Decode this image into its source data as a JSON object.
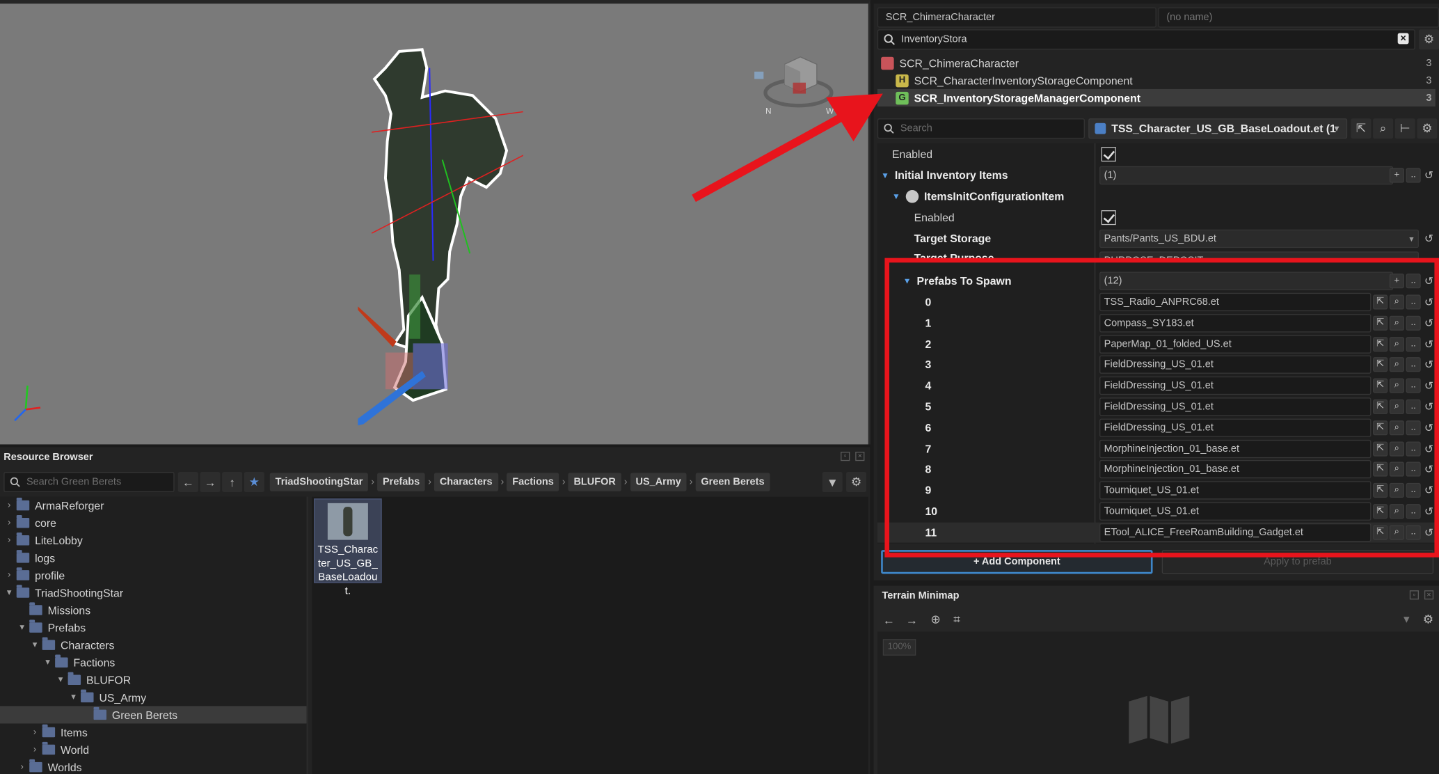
{
  "resource_browser": {
    "title": "Resource Browser",
    "search_placeholder": "Search Green Berets",
    "breadcrumbs": [
      "TriadShootingStar",
      "Prefabs",
      "Characters",
      "Factions",
      "BLUFOR",
      "US_Army",
      "Green Berets"
    ],
    "tree": [
      {
        "label": "ArmaReforger",
        "depth": 0,
        "caret": "›"
      },
      {
        "label": "core",
        "depth": 0,
        "caret": "›"
      },
      {
        "label": "LiteLobby",
        "depth": 0,
        "caret": "›"
      },
      {
        "label": "logs",
        "depth": 0,
        "caret": ""
      },
      {
        "label": "profile",
        "depth": 0,
        "caret": "›"
      },
      {
        "label": "TriadShootingStar",
        "depth": 0,
        "caret": "▾"
      },
      {
        "label": "Missions",
        "depth": 1,
        "caret": ""
      },
      {
        "label": "Prefabs",
        "depth": 1,
        "caret": "▾"
      },
      {
        "label": "Characters",
        "depth": 2,
        "caret": "▾"
      },
      {
        "label": "Factions",
        "depth": 3,
        "caret": "▾"
      },
      {
        "label": "BLUFOR",
        "depth": 4,
        "caret": "▾"
      },
      {
        "label": "US_Army",
        "depth": 5,
        "caret": "▾"
      },
      {
        "label": "Green Berets",
        "depth": 6,
        "caret": "",
        "selected": true
      },
      {
        "label": "Items",
        "depth": 2,
        "caret": "›"
      },
      {
        "label": "World",
        "depth": 2,
        "caret": "›"
      },
      {
        "label": "Worlds",
        "depth": 1,
        "caret": "›"
      }
    ],
    "file": {
      "label": "TSS_Character_US_GB_BaseLoadout."
    }
  },
  "inspector": {
    "entity_class": "SCR_ChimeraCharacter",
    "entity_name_placeholder": "(no name)",
    "component_search": "InventoryStora",
    "components": [
      {
        "label": "SCR_ChimeraCharacter",
        "count": "3",
        "badge": "",
        "badge_color": "#c9545a"
      },
      {
        "label": "SCR_CharacterInventoryStorageComponent",
        "count": "3",
        "badge": "H",
        "badge_color": "#c9b84a"
      },
      {
        "label": "SCR_InventoryStorageManagerComponent",
        "count": "3",
        "badge": "G",
        "badge_color": "#6fbf5a",
        "selected": true
      }
    ],
    "prop_search_placeholder": "Search",
    "prefab_name": "TSS_Character_US_GB_BaseLoadout.et (1",
    "enabled_label": "Enabled",
    "initial_items_label": "Initial Inventory Items",
    "initial_items_count": "(1)",
    "item_config_label": "ItemsInitConfigurationItem",
    "item_enabled_label": "Enabled",
    "target_storage_label": "Target Storage",
    "target_storage_value": "Pants/Pants_US_BDU.et",
    "target_purpose_label": "Target Purpose",
    "target_purpose_value": "PURPOSE_DEPOSIT",
    "prefabs_label": "Prefabs To Spawn",
    "prefabs_count": "(12)",
    "prefabs": [
      {
        "index": "0",
        "value": "TSS_Radio_ANPRC68.et"
      },
      {
        "index": "1",
        "value": "Compass_SY183.et"
      },
      {
        "index": "2",
        "value": "PaperMap_01_folded_US.et"
      },
      {
        "index": "3",
        "value": "FieldDressing_US_01.et"
      },
      {
        "index": "4",
        "value": "FieldDressing_US_01.et"
      },
      {
        "index": "5",
        "value": "FieldDressing_US_01.et"
      },
      {
        "index": "6",
        "value": "FieldDressing_US_01.et"
      },
      {
        "index": "7",
        "value": "MorphineInjection_01_base.et"
      },
      {
        "index": "8",
        "value": "MorphineInjection_01_base.et"
      },
      {
        "index": "9",
        "value": "Tourniquet_US_01.et"
      },
      {
        "index": "10",
        "value": "Tourniquet_US_01.et"
      },
      {
        "index": "11",
        "value": "ETool_ALICE_FreeRoamBuilding_Gadget.et"
      }
    ],
    "add_component_label": "+ Add Component",
    "apply_label": "Apply to prefab"
  },
  "terrain_minimap": {
    "title": "Terrain Minimap",
    "zoom": "100%"
  },
  "colors": {
    "accent": "#3e86c8",
    "annotation_red": "#e8141c"
  }
}
